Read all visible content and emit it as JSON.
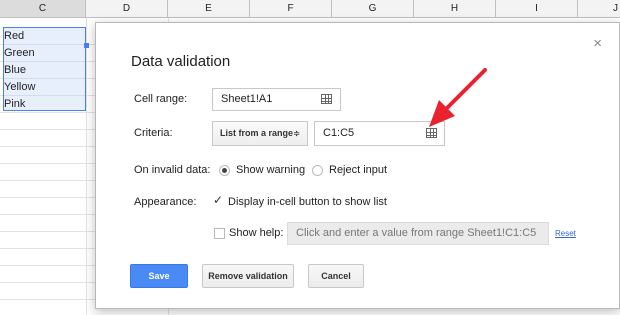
{
  "sheet": {
    "columns": [
      "C",
      "D",
      "E",
      "F",
      "G",
      "H",
      "I",
      "J"
    ],
    "cells": [
      "Red",
      "Green",
      "Blue",
      "Yellow",
      "Pink"
    ]
  },
  "dialog": {
    "title": "Data validation",
    "close_glyph": "×",
    "cell_range": {
      "label": "Cell range:",
      "value": "Sheet1!A1"
    },
    "criteria": {
      "label": "Criteria:",
      "type": "List from a range",
      "type_arrows": "≑",
      "range_value": "C1:C5"
    },
    "on_invalid": {
      "label": "On invalid data:",
      "options": [
        "Show warning",
        "Reject input"
      ],
      "selected": "Show warning"
    },
    "appearance": {
      "label": "Appearance:",
      "check_glyph": "✓",
      "display_button_label": "Display in-cell button to show list",
      "display_button_checked": true
    },
    "help": {
      "label": "Show help:",
      "checked": false,
      "placeholder": "Click and enter a value from range Sheet1!C1:C5",
      "reset_label": "Reset"
    },
    "buttons": {
      "save": "Save",
      "remove": "Remove validation",
      "cancel": "Cancel"
    }
  },
  "colors": {
    "accent": "#4a8af4",
    "annotation_arrow": "#e8232e",
    "selection_border": "#4a80f5"
  }
}
